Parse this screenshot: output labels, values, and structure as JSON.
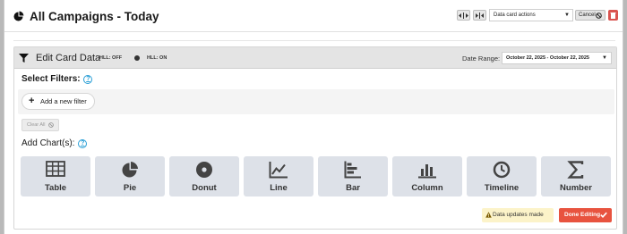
{
  "header": {
    "title": "All Campaigns - Today",
    "actions_select": "Data card actions",
    "cancel_label": "Cancel"
  },
  "edit_panel": {
    "title": "Edit Card Data",
    "hll_off": "HLL: OFF",
    "hll_on": "HLL: ON",
    "date_range_label": "Date Range:",
    "date_range_value": "October 22, 2025 - October 22, 2025"
  },
  "filters": {
    "label": "Select Filters:",
    "help": "?",
    "add_filter": "Add a new filter",
    "clear_all": "Clear All"
  },
  "charts": {
    "label": "Add Chart(s):",
    "help": "?",
    "items": [
      {
        "label": "Table",
        "icon": "table-icon"
      },
      {
        "label": "Pie",
        "icon": "pie-icon"
      },
      {
        "label": "Donut",
        "icon": "donut-icon"
      },
      {
        "label": "Line",
        "icon": "line-chart-icon"
      },
      {
        "label": "Bar",
        "icon": "bar-chart-icon"
      },
      {
        "label": "Column",
        "icon": "column-chart-icon"
      },
      {
        "label": "Timeline",
        "icon": "clock-icon"
      },
      {
        "label": "Number",
        "icon": "sigma-icon"
      }
    ]
  },
  "footer": {
    "notice": "Data updates made",
    "done_label": "Done Editing"
  },
  "colors": {
    "done": "#e8533f",
    "trash": "#d9534f",
    "notice_bg": "#fcf3c9",
    "help": "#2a9fd6",
    "tile_bg": "#dde1e8"
  }
}
